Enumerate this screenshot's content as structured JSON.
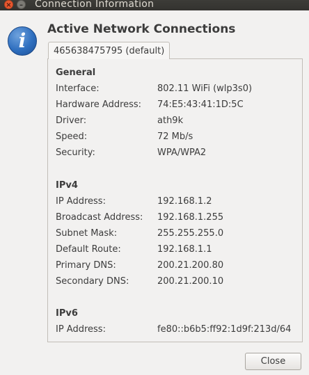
{
  "window": {
    "title": "Connection Information",
    "close_glyph": "×",
    "minimize_glyph": "–"
  },
  "icon": {
    "name": "info-icon",
    "glyph": "i"
  },
  "heading": "Active Network Connections",
  "tab": {
    "label": "465638475795 (default)"
  },
  "general": {
    "title": "General",
    "rows": [
      {
        "label": "Interface:",
        "value": "802.11 WiFi (wlp3s0)"
      },
      {
        "label": "Hardware Address:",
        "value": "74:E5:43:41:1D:5C"
      },
      {
        "label": "Driver:",
        "value": "ath9k"
      },
      {
        "label": "Speed:",
        "value": "72 Mb/s"
      },
      {
        "label": "Security:",
        "value": "WPA/WPA2"
      }
    ]
  },
  "ipv4": {
    "title": "IPv4",
    "rows": [
      {
        "label": "IP Address:",
        "value": "192.168.1.2"
      },
      {
        "label": "Broadcast Address:",
        "value": "192.168.1.255"
      },
      {
        "label": "Subnet Mask:",
        "value": "255.255.255.0"
      },
      {
        "label": "Default Route:",
        "value": "192.168.1.1"
      },
      {
        "label": "Primary DNS:",
        "value": "200.21.200.80"
      },
      {
        "label": "Secondary DNS:",
        "value": "200.21.200.10"
      }
    ]
  },
  "ipv6": {
    "title": "IPv6",
    "rows": [
      {
        "label": "IP Address:",
        "value": "fe80::b6b5:ff92:1d9f:213d/64"
      }
    ]
  },
  "buttons": {
    "close_label": "Close"
  }
}
